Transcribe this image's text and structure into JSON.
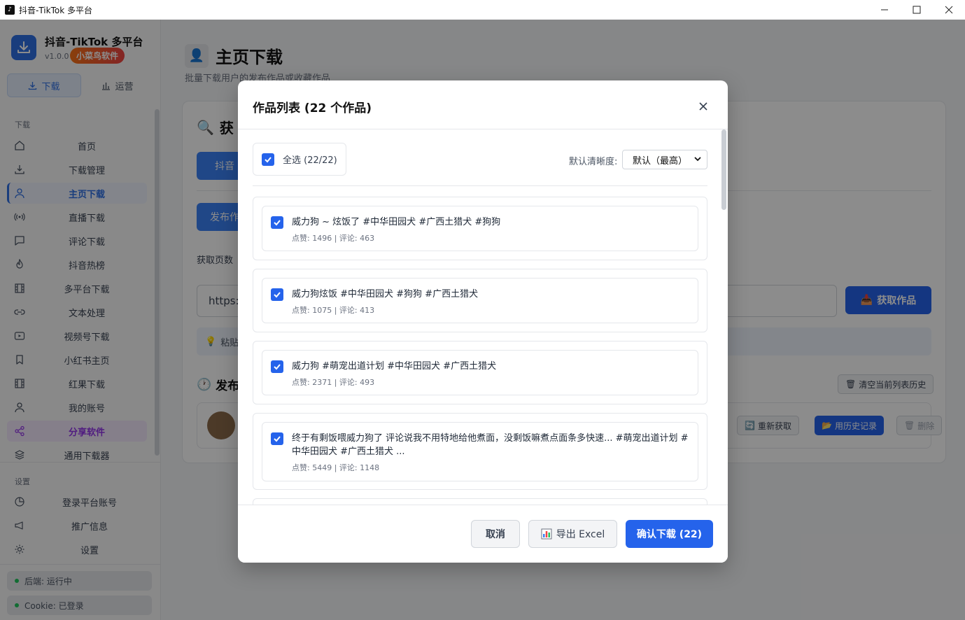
{
  "window": {
    "title": "抖音-TikTok 多平台"
  },
  "brand": {
    "name": "抖音-TikTok 多平台",
    "version": "v1.0.0 ·",
    "badge": "小菜鸟软件"
  },
  "mode_tabs": [
    {
      "label": "下载"
    },
    {
      "label": "运营"
    }
  ],
  "sidebar": {
    "section_download": "下载",
    "items": [
      {
        "label": "首页"
      },
      {
        "label": "下载管理"
      },
      {
        "label": "主页下载"
      },
      {
        "label": "直播下载"
      },
      {
        "label": "评论下载"
      },
      {
        "label": "抖音热榜"
      },
      {
        "label": "多平台下载"
      },
      {
        "label": "文本处理"
      },
      {
        "label": "视频号下载"
      },
      {
        "label": "小红书主页"
      },
      {
        "label": "红果下载"
      },
      {
        "label": "我的账号"
      },
      {
        "label": "分享软件"
      },
      {
        "label": "通用下载器"
      }
    ],
    "section_settings": "设置",
    "settings_items": [
      {
        "label": "登录平台账号"
      },
      {
        "label": "推广信息"
      },
      {
        "label": "设置"
      }
    ],
    "status": [
      {
        "label": "后端: 运行中"
      },
      {
        "label": "Cookie: 已登录"
      }
    ]
  },
  "page": {
    "icon": "👤",
    "title": "主页下载",
    "subtitle": "批量下载用户的发布作品或收藏作品",
    "bg": {
      "heading1": "获",
      "tab1": "抖音",
      "tab2": "发布作",
      "label": "获取页数",
      "input_value": "https:/",
      "fetch_button": "获取作品",
      "hint": "粘贴",
      "heading2": "发布",
      "clear_history": "清空当前列表历史",
      "refetch": "重新获取",
      "use_history": "用历史记录",
      "delete": "删除"
    }
  },
  "modal": {
    "title": "作品列表 (22 个作品)",
    "select_all": "全选 (22/22)",
    "quality_label": "默认清晰度:",
    "quality_value": "默认（最高）",
    "items": [
      {
        "title": "威力狗 ~ 炫饭了 #中华田园犬 #广西土猎犬 #狗狗",
        "meta": "点赞: 1496 | 评论: 463"
      },
      {
        "title": "威力狗炫饭 #中华田园犬 #狗狗 #广西土猎犬",
        "meta": "点赞: 1075 | 评论: 413"
      },
      {
        "title": "威力狗 #萌宠出道计划 #中华田园犬 #广西土猎犬",
        "meta": "点赞: 2371 | 评论: 493"
      },
      {
        "title": "终于有剩饭喂威力狗了 评论说我不用特地给他煮面，没剩饭嘛煮点面条多快速... #萌宠出道计划 #中华田园犬 #广西土猎犬 ...",
        "meta": "点赞: 5449 | 评论: 1148"
      }
    ],
    "cancel": "取消",
    "export": "导出 Excel",
    "confirm": "确认下载 (22)"
  }
}
